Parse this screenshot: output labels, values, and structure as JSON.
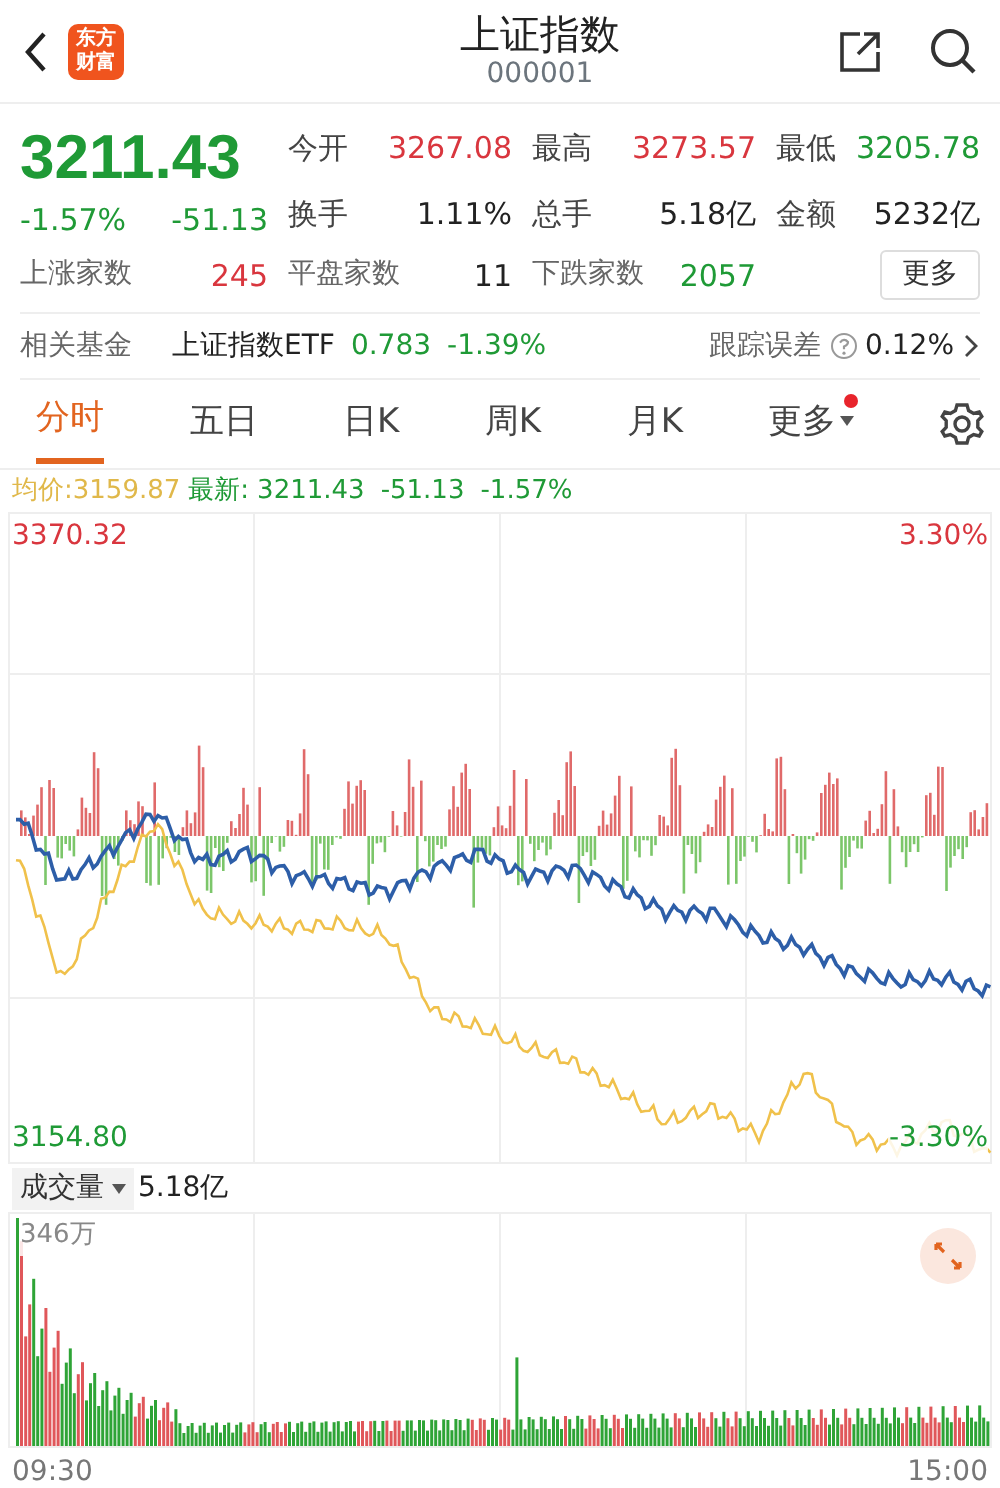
{
  "header": {
    "logo": [
      "东方",
      "财富"
    ],
    "title": "上证指数",
    "code": "000001"
  },
  "quote": {
    "price": "3211.43",
    "change_pct": "-1.57%",
    "change": "-51.13",
    "color": "#1f9a36",
    "stats": [
      {
        "label": "今开",
        "value": "3267.08",
        "color": "#d9363e"
      },
      {
        "label": "最高",
        "value": "3273.57",
        "color": "#d9363e"
      },
      {
        "label": "最低",
        "value": "3205.78",
        "color": "#1f9a36"
      },
      {
        "label": "换手",
        "value": "1.11%",
        "color": "#222222"
      },
      {
        "label": "总手",
        "value": "5.18亿",
        "color": "#222222"
      },
      {
        "label": "金额",
        "value": "5232亿",
        "color": "#222222"
      }
    ],
    "breadth": [
      {
        "label": "上涨家数",
        "value": "245",
        "color": "#d9363e"
      },
      {
        "label": "平盘家数",
        "value": "11",
        "color": "#222222"
      },
      {
        "label": "下跌家数",
        "value": "2057",
        "color": "#1f9a36"
      }
    ],
    "more_button": "更多"
  },
  "related_fund": {
    "label": "相关基金",
    "name": "上证指数ETF",
    "price": "0.783",
    "change": "-1.39%",
    "color": "#1f9a36",
    "tracking_label": "跟踪误差",
    "tracking_value": "0.12%"
  },
  "tabs": [
    {
      "label": "分时",
      "selected": true,
      "kind": "tab",
      "notification": false
    },
    {
      "label": "五日",
      "selected": false,
      "kind": "tab",
      "notification": false
    },
    {
      "label": "日K",
      "selected": false,
      "kind": "tab",
      "notification": false
    },
    {
      "label": "周K",
      "selected": false,
      "kind": "tab",
      "notification": false
    },
    {
      "label": "月K",
      "selected": false,
      "kind": "tab",
      "notification": false
    },
    {
      "label": "更多",
      "selected": false,
      "kind": "dropdown",
      "notification": true
    }
  ],
  "intraday": {
    "avg_label": "均价:",
    "avg_value": "3159.87",
    "last_label": "最新:",
    "last_value": "3211.43",
    "change": "-51.13",
    "change_pct": "-1.57%",
    "y_max": "3370.32",
    "y_min": "3154.80",
    "pct_max": "3.30%",
    "pct_min": "-3.30%"
  },
  "volume": {
    "selector": "成交量",
    "total": "5.18亿",
    "max_label": "346万",
    "start_time": "09:30",
    "end_time": "15:00"
  }
}
